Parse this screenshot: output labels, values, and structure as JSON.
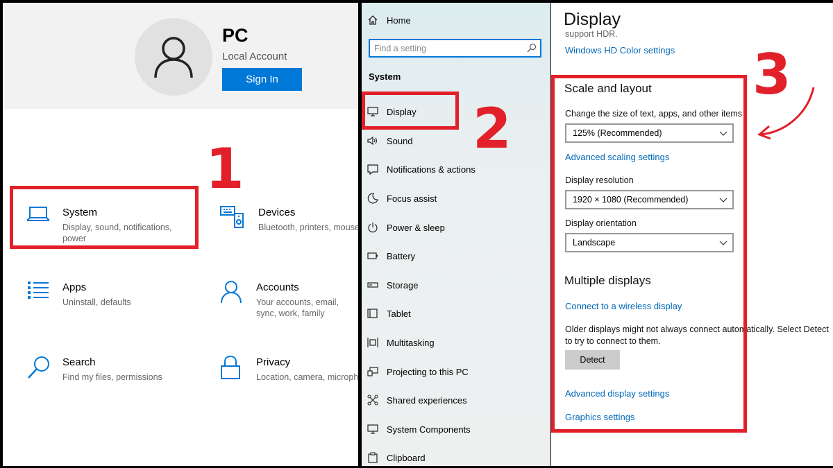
{
  "home": {
    "account_name": "PC",
    "account_type": "Local Account",
    "sign_in_label": "Sign In",
    "tiles": [
      {
        "title": "System",
        "desc": "Display, sound, notifications, power",
        "icon": "laptop-icon"
      },
      {
        "title": "Devices",
        "desc": "Bluetooth, printers, mouse",
        "icon": "devices-icon"
      },
      {
        "title": "Apps",
        "desc": "Uninstall, defaults",
        "icon": "apps-list-icon"
      },
      {
        "title": "Accounts",
        "desc": "Your accounts, email, sync, work, family",
        "icon": "person-icon"
      },
      {
        "title": "Search",
        "desc": "Find my files, permissions",
        "icon": "search-icon"
      },
      {
        "title": "Privacy",
        "desc": "Location, camera, microphone",
        "icon": "lock-icon"
      }
    ]
  },
  "nav": {
    "home_label": "Home",
    "search_placeholder": "Find a setting",
    "section_label": "System",
    "items": [
      {
        "label": "Display",
        "icon": "monitor-icon"
      },
      {
        "label": "Sound",
        "icon": "speaker-icon"
      },
      {
        "label": "Notifications & actions",
        "icon": "notification-icon"
      },
      {
        "label": "Focus assist",
        "icon": "moon-icon"
      },
      {
        "label": "Power & sleep",
        "icon": "power-icon"
      },
      {
        "label": "Battery",
        "icon": "battery-icon"
      },
      {
        "label": "Storage",
        "icon": "storage-icon"
      },
      {
        "label": "Tablet",
        "icon": "tablet-icon"
      },
      {
        "label": "Multitasking",
        "icon": "multitasking-icon"
      },
      {
        "label": "Projecting to this PC",
        "icon": "projecting-icon"
      },
      {
        "label": "Shared experiences",
        "icon": "shared-icon"
      },
      {
        "label": "System Components",
        "icon": "components-icon"
      },
      {
        "label": "Clipboard",
        "icon": "clipboard-icon"
      }
    ]
  },
  "display": {
    "title": "Display",
    "hdr_partial": "support HDR.",
    "hd_color_link": "Windows HD Color settings",
    "scale_heading": "Scale and layout",
    "scale_label": "Change the size of text, apps, and other items",
    "scale_value": "125% (Recommended)",
    "advanced_scaling_link": "Advanced scaling settings",
    "resolution_label": "Display resolution",
    "resolution_value": "1920 × 1080 (Recommended)",
    "orientation_label": "Display orientation",
    "orientation_value": "Landscape",
    "multi_heading": "Multiple displays",
    "wireless_link": "Connect to a wireless display",
    "older_text": "Older displays might not always connect automatically. Select Detect to try to connect to them.",
    "detect_label": "Detect",
    "advanced_display_link": "Advanced display settings",
    "graphics_link": "Graphics settings"
  },
  "annotations": {
    "step1": "1",
    "step2": "2",
    "step3": "3",
    "highlight_color": "#e2202a"
  },
  "colors": {
    "accent": "#0078d7",
    "link": "#0067b8"
  }
}
